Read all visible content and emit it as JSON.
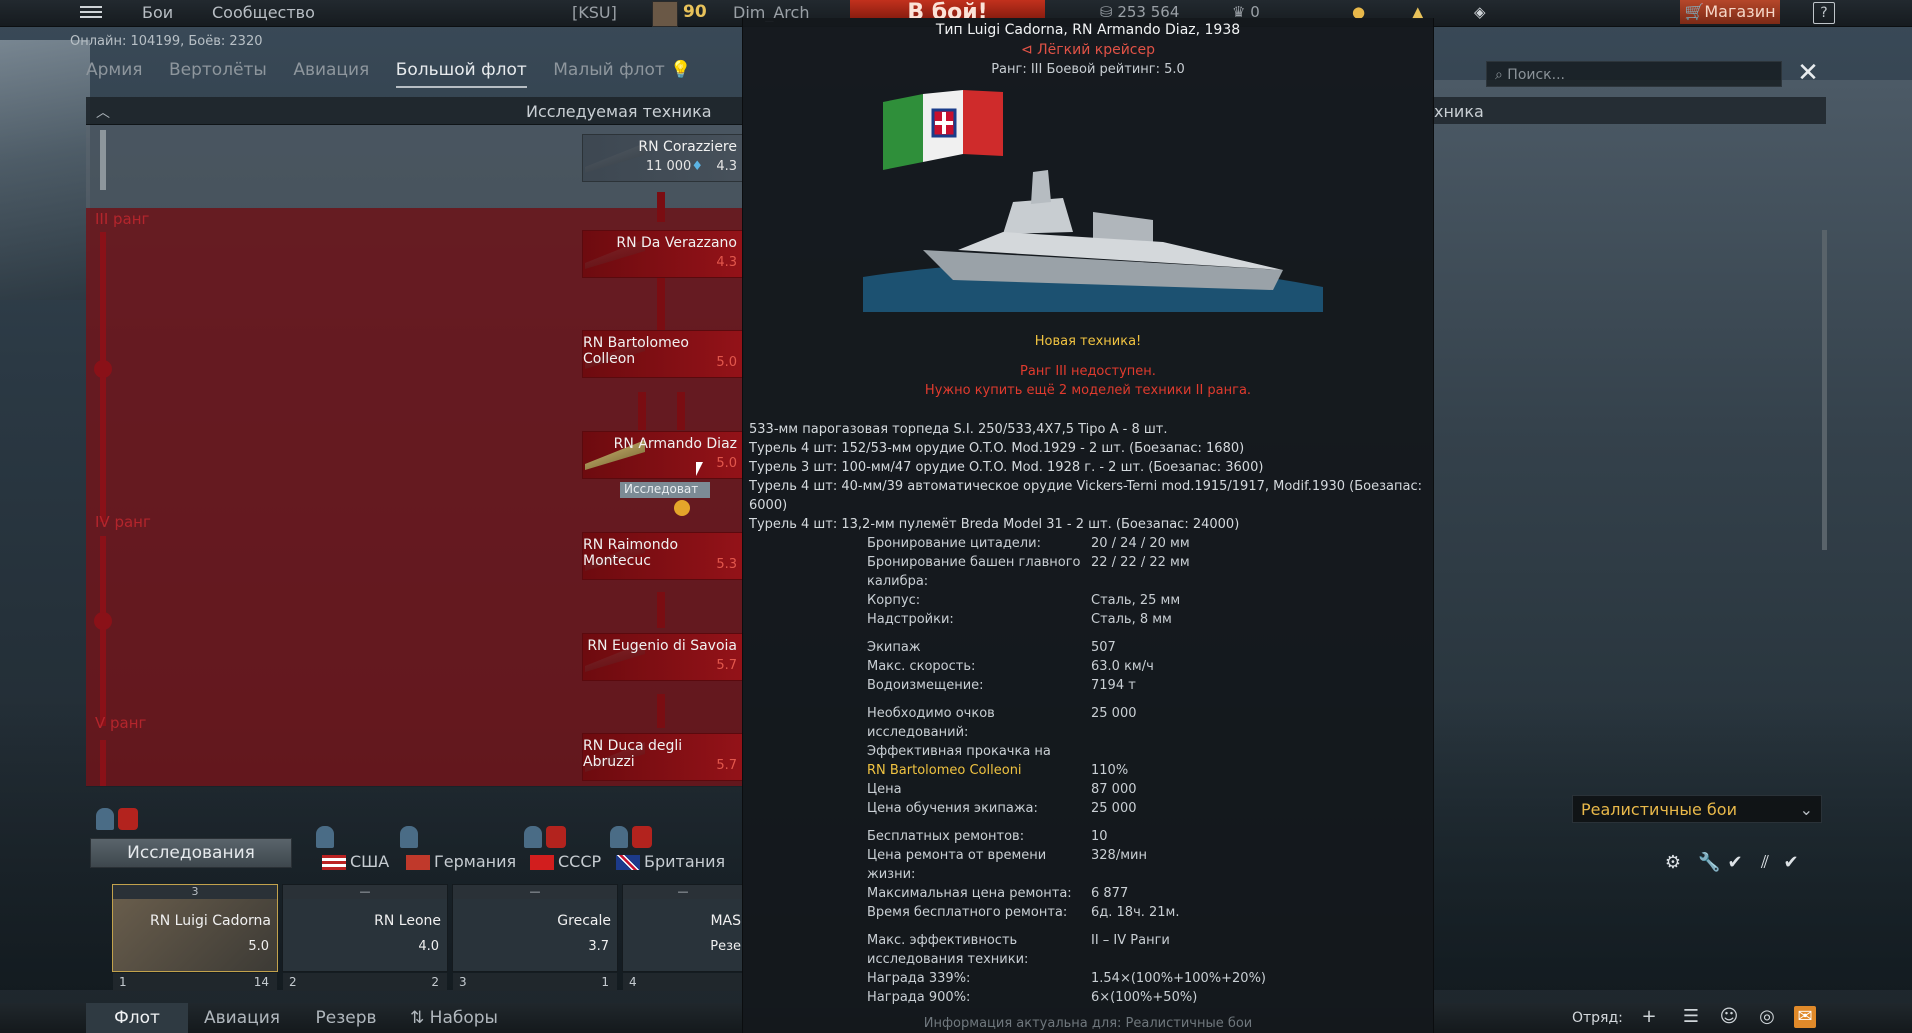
{
  "top_bar": {
    "battles": "Бои",
    "community": "Сообщество",
    "squadron_tag": "[KSU]",
    "player_level": "90",
    "player_name": "Dim_Arch",
    "battle_button": "В бой!",
    "silver": "253 564",
    "gold": "0",
    "shop": "Магазин",
    "help": "?"
  },
  "online_text": "Онлайн: 104199, Боёв: 2320",
  "tabs": [
    "Армия",
    "Вертолёты",
    "Авиация",
    "Большой флот",
    "Малый флот"
  ],
  "active_tab": "Большой флот",
  "tree": {
    "header": "Исследуемая техника",
    "ranks": [
      "III ранг",
      "IV ранг",
      "V ранг"
    ],
    "ships": [
      {
        "name": "RN Corazziere",
        "cost": "11 000",
        "rating": "4.3"
      },
      {
        "name": "RN Da Verazzano",
        "rating": "4.3"
      },
      {
        "name": "RN Bartolomeo Colleon",
        "rating": "5.0"
      },
      {
        "name": "RN Armando Diaz",
        "rating": "5.0"
      },
      {
        "name": "RN Raimondo Montecuc",
        "rating": "5.3"
      },
      {
        "name": "RN Eugenio di Savoia",
        "rating": "5.7"
      },
      {
        "name": "RN Duca degli Abruzzi",
        "rating": "5.7"
      }
    ],
    "research_tag": "Исследоват"
  },
  "research_button": "Исследования",
  "nations": [
    "США",
    "Германия",
    "СССР",
    "Британия"
  ],
  "slots": [
    {
      "name": "RN Luigi Cadorna",
      "rating": "5.0",
      "crew": "1",
      "count": "14",
      "top": "3"
    },
    {
      "name": "RN Leone",
      "rating": "4.0",
      "crew": "2",
      "count": "2",
      "top": "—"
    },
    {
      "name": "Grecale",
      "rating": "3.7",
      "crew": "3",
      "count": "1",
      "top": "—"
    },
    {
      "name": "MAS",
      "rating": "Резе",
      "crew": "4",
      "count": "",
      "top": "—"
    }
  ],
  "bottom_tabs": [
    "Флот",
    "Авиация",
    "Резерв",
    "Наборы"
  ],
  "squad_label": "Отряд:",
  "search_placeholder": "Поиск...",
  "right_header": "хника",
  "game_mode": "Реалистичные бои",
  "tooltip": {
    "title": "Тип Luigi Cadorna, RN Armando Diaz, 1938",
    "class": "Лёгкий крейсер",
    "rank": "Ранг: III   Боевой рейтинг: 5.0",
    "new_vehicle": "Новая техника!",
    "locked_1": "Ранг III недоступен.",
    "locked_2": "Нужно купить ещё 2 моделей техники II ранга.",
    "weapons": [
      "533-мм парогазовая торпеда S.I. 250/533,4X7,5 Tipo A - 8 шт.",
      "Турель 4 шт: 152/53-мм орудие O.T.O. Mod.1929 - 2 шт. (Боезапас: 1680)",
      "Турель 3 шт: 100-мм/47 орудие O.T.O. Mod. 1928 г. - 2 шт. (Боезапас: 3600)",
      "Турель 4 шт: 40-мм/39 автоматическое орудие Vickers-Terni mod.1915/1917, Modif.1930 (Боезапас: 6000)",
      "Турель 4 шт: 13,2-мм пулемёт Breda Model 31 - 2 шт. (Боезапас: 24000)"
    ],
    "stats": [
      {
        "label": "Бронирование цитадели:",
        "value": "20 / 24 / 20 мм"
      },
      {
        "label": "Бронирование башен главного калибра:",
        "value": "22 / 22 / 22 мм"
      },
      {
        "label": "Корпус:",
        "value": "Сталь, 25 мм"
      },
      {
        "label": "Надстройки:",
        "value": "Сталь, 8 мм"
      },
      {
        "gap": true
      },
      {
        "label": "Экипаж",
        "value": "507"
      },
      {
        "label": "Макс. скорость:",
        "value": "63.0 км/ч"
      },
      {
        "label": "Водоизмещение:",
        "value": "7194 т"
      },
      {
        "gap": true
      },
      {
        "label": "Необходимо очков исследований:",
        "value": "25 000"
      },
      {
        "label": "Эффективная прокачка на",
        "value": ""
      },
      {
        "label": "RN Bartolomeo Colleoni",
        "value": "110%",
        "highlight": true
      },
      {
        "label": "Цена",
        "value": "87 000"
      },
      {
        "label": "Цена обучения экипажа:",
        "value": "25 000"
      },
      {
        "gap": true
      },
      {
        "label": "Бесплатных ремонтов:",
        "value": "10"
      },
      {
        "label": "Цена ремонта от времени жизни:",
        "value": "328/мин"
      },
      {
        "label": "Максимальная цена ремонта:",
        "value": "6 877"
      },
      {
        "label": "Время бесплатного ремонта:",
        "value": "6д. 18ч. 21м."
      },
      {
        "gap": true
      },
      {
        "label": "Макс. эффективность исследования техники:",
        "value": "II – IV Ранги"
      },
      {
        "label": "Награда 339%:",
        "value": "1.54×(100%+100%+20%)"
      },
      {
        "label": "Награда 900%:",
        "value": "6×(100%+50%)"
      }
    ],
    "footer": "Информация актуальна для: Реалистичные бои"
  },
  "colors": {
    "tree_red": "#801419",
    "rating_red": "#e2574c",
    "highlight_gold": "#f0c341",
    "locked_red": "#e03b2e",
    "battle_button": "#c2311d"
  }
}
